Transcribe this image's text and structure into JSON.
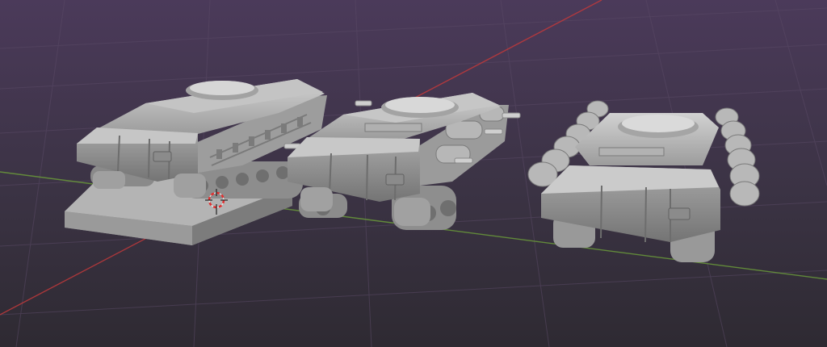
{
  "app": {
    "view": "3d-viewport",
    "colors": {
      "background_top": "#4a3a58",
      "background_bottom": "#2f2b33",
      "grid_line": "#5a4a66",
      "x_axis": "#c0393b",
      "y_axis": "#6a9a3a",
      "model_base": "#9a9a9a",
      "model_light": "#c9c9c9",
      "model_shadow": "#6e6e6e",
      "cursor_red": "#e03030",
      "cursor_white": "#f0f0f0"
    },
    "icons": {
      "cursor": "3d-cursor-icon"
    },
    "objects": [
      {
        "name": "tank-hull-on-base"
      },
      {
        "name": "tank-hull-with-side-pods"
      },
      {
        "name": "tank-hull-with-armor-rollers"
      }
    ]
  }
}
